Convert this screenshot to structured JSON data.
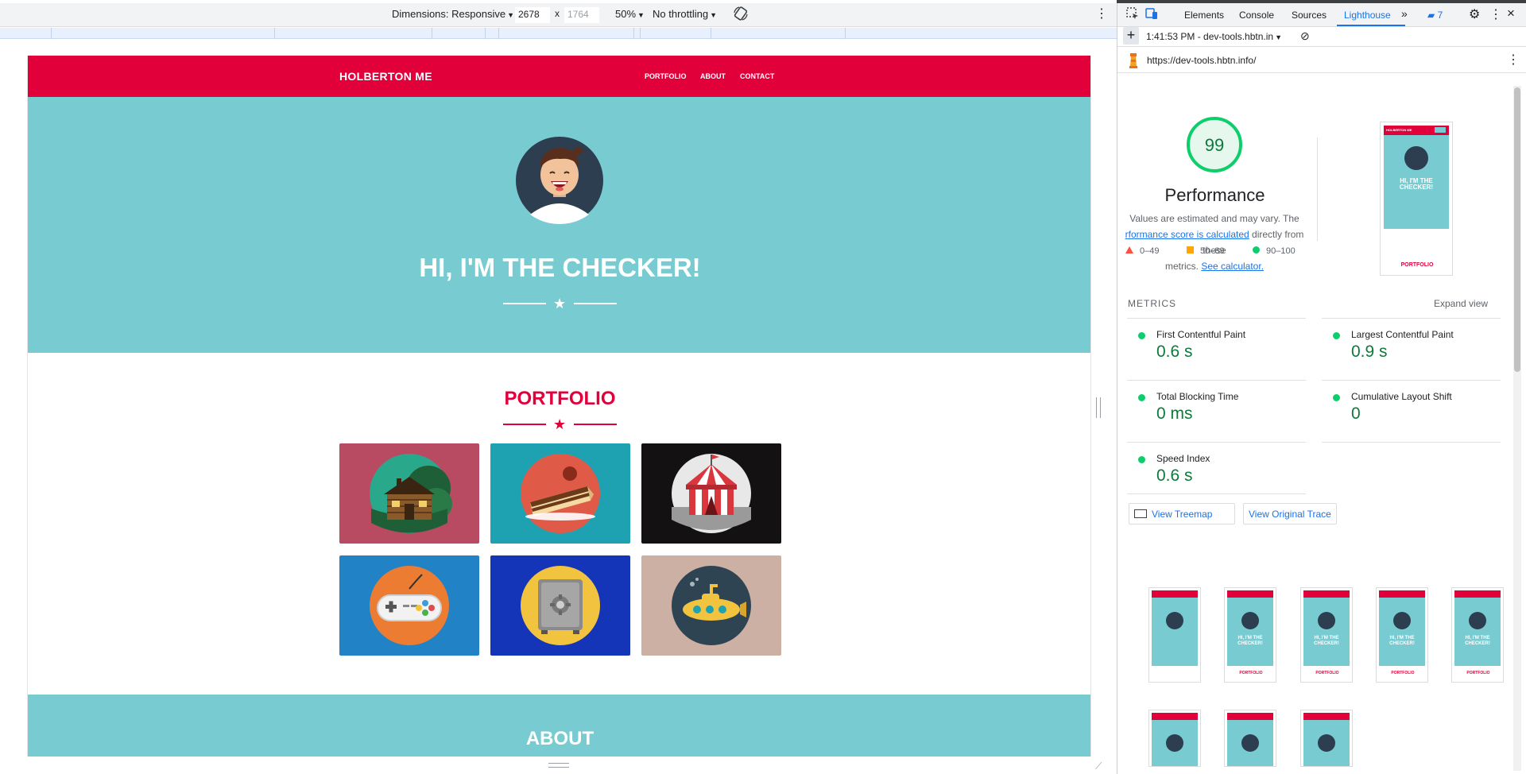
{
  "device_toolbar": {
    "dimensions_label": "Dimensions: Responsive",
    "width_value": "2678",
    "times": "x",
    "height_placeholder": "1764",
    "zoom": "50%",
    "throttling": "No throttling"
  },
  "site": {
    "brand": "HOLBERTON ME",
    "nav": [
      "PORTFOLIO",
      "ABOUT",
      "CONTACT"
    ],
    "hero_title": "HI, I'M THE CHECKER!",
    "portfolio_title": "PORTFOLIO",
    "about_title": "ABOUT",
    "colors": {
      "header": "#e2003b",
      "hero": "#78ccd1",
      "accent": "#e2003b"
    },
    "portfolio_tiles": [
      {
        "name": "cabin",
        "bg": "#b84a62"
      },
      {
        "name": "cake",
        "bg": "#1ea2b2"
      },
      {
        "name": "circus",
        "bg": "#131111"
      },
      {
        "name": "game-controller",
        "bg": "#2282c6"
      },
      {
        "name": "safe",
        "bg": "#1535b8"
      },
      {
        "name": "submarine",
        "bg": "#cdb0a4"
      }
    ]
  },
  "devtools": {
    "tabs": [
      "Elements",
      "Console",
      "Sources",
      "Lighthouse"
    ],
    "active_tab": "Lighthouse",
    "issues_count": "7",
    "report_selector": "1:41:53 PM - dev-tools.hbtn.in",
    "url": "https://dev-tools.hbtn.info/",
    "score": "99",
    "category": "Performance",
    "desc_prefix": "Values are estimated and may vary. The",
    "desc_link": "rformance score is calculated",
    "desc_mid": "directly from these",
    "desc_line3": "metrics.",
    "calc_link": "See calculator.",
    "legend": [
      "0–49",
      "50–89",
      "90–100"
    ],
    "metrics_label": "METRICS",
    "expand_view": "Expand view",
    "metrics": [
      {
        "label": "First Contentful Paint",
        "value": "0.6 s"
      },
      {
        "label": "Largest Contentful Paint",
        "value": "0.9 s"
      },
      {
        "label": "Total Blocking Time",
        "value": "0 ms"
      },
      {
        "label": "Cumulative Layout Shift",
        "value": "0"
      },
      {
        "label": "Speed Index",
        "value": "0.6 s"
      }
    ],
    "buttons": {
      "treemap": "View Treemap",
      "trace": "View Original Trace"
    },
    "thumb_text": {
      "brand": "HOLBERTON ME",
      "hero": "HI, I'M THE CHECKER!",
      "portfolio": "PORTFOLIO"
    }
  }
}
